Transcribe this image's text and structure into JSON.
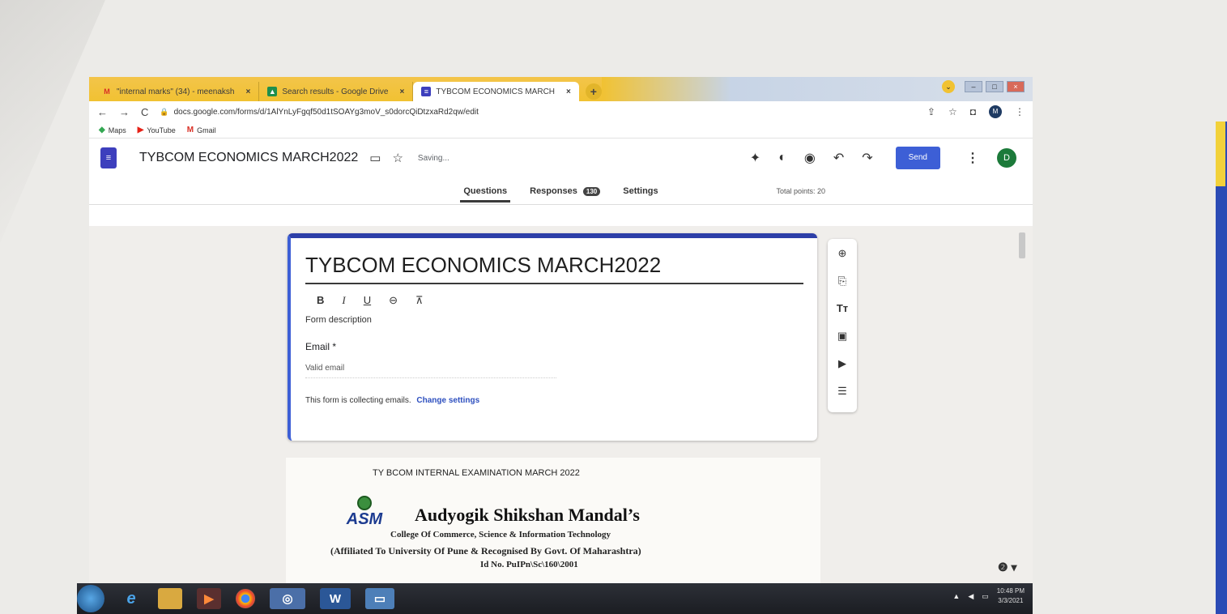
{
  "browser": {
    "tabs": [
      {
        "label": "\"internal marks\" (34) - meenaksh",
        "favicon": "M",
        "active": false
      },
      {
        "label": "Search results - Google Drive",
        "favicon": "drive-icon",
        "active": false
      },
      {
        "label": "TYBCOM ECONOMICS MARCH",
        "favicon": "forms-icon",
        "active": true
      }
    ],
    "new_tab": "+",
    "url": "docs.google.com/forms/d/1AlYnLyFgqf50d1tSOAYg3moV_s0dorcQiDtzxaRd2qw/edit",
    "bookmarks": [
      {
        "label": "Maps",
        "icon": "maps-icon"
      },
      {
        "label": "YouTube",
        "icon": "youtube-icon"
      },
      {
        "label": "Gmail",
        "icon": "gmail-icon"
      }
    ],
    "profile_initial": "M"
  },
  "forms_header": {
    "title": "TYBCOM ECONOMICS MARCH2022",
    "status": "Saving...",
    "send_label": "Send",
    "avatar_initial": "D",
    "accent": "#3d5fd6"
  },
  "nav_tabs": {
    "questions": "Questions",
    "responses": "Responses",
    "responses_count": "130",
    "settings": "Settings",
    "total_points": "Total points: 20"
  },
  "title_card": {
    "title": "TYBCOM ECONOMICS MARCH2022",
    "format_buttons": [
      "B",
      "I",
      "U",
      "⊖",
      "⊼"
    ],
    "description_placeholder": "Form description",
    "email_label": "Email *",
    "email_placeholder": "Valid email",
    "collecting_note": "This form is collecting emails.",
    "change_settings": "Change settings"
  },
  "side_toolbar": [
    "add-question-icon",
    "import-questions-icon",
    "add-title-icon",
    "add-image-icon",
    "add-video-icon",
    "add-section-icon"
  ],
  "header_image": {
    "exam_title": "TY BCOM INTERNAL EXAMINATION MARCH 2022",
    "logo_text": "ASM",
    "institution": "Audyogik Shikshan Mandal’s",
    "college": "College Of Commerce, Science & Information Technology",
    "affiliation": "(Affiliated To University Of Pune & Recognised By Govt. Of Maharashtra)",
    "id_no": "Id No. PuIPn\\Sc\\160\\2001"
  },
  "taskbar": {
    "time": "10:48 PM",
    "date": "3/3/2021"
  }
}
